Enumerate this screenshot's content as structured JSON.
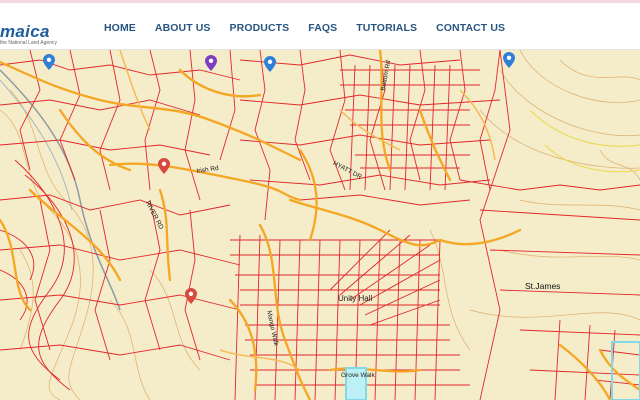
{
  "header": {
    "logo_text": "maica",
    "logo_tagline": "the National Land Agency",
    "nav": [
      {
        "label": "HOME"
      },
      {
        "label": "ABOUT US"
      },
      {
        "label": "PRODUCTS"
      },
      {
        "label": "FAQS"
      },
      {
        "label": "TUTORIALS"
      },
      {
        "label": "CONTACT US"
      }
    ]
  },
  "map": {
    "labels": {
      "unity_hall": "Unity Hall",
      "st_james": "St.James",
      "irish_rd": "Irish Rd",
      "hyatt_dr": "HYATT DR",
      "river_rd": "RIVER RD",
      "mango_walk": "Mango Walk",
      "grove_walk": "Grove Walk",
      "bottom_rd": "Bottom Rd"
    },
    "colors": {
      "background": "#f5ecc9",
      "parcel_line": "#e3262b",
      "road": "#f5a623",
      "contour": "#d8a35c",
      "highlight": "#7fd9e6",
      "marker_blue": "#2f7fd6",
      "marker_red": "#d64a3f",
      "marker_purple": "#7b3fbf"
    },
    "markers": [
      {
        "icon": "map-pin-blue-icon"
      },
      {
        "icon": "map-pin-purple-icon"
      },
      {
        "icon": "map-pin-blue-icon"
      },
      {
        "icon": "map-pin-blue-icon"
      },
      {
        "icon": "map-pin-red-icon"
      },
      {
        "icon": "map-pin-red-icon"
      }
    ]
  }
}
